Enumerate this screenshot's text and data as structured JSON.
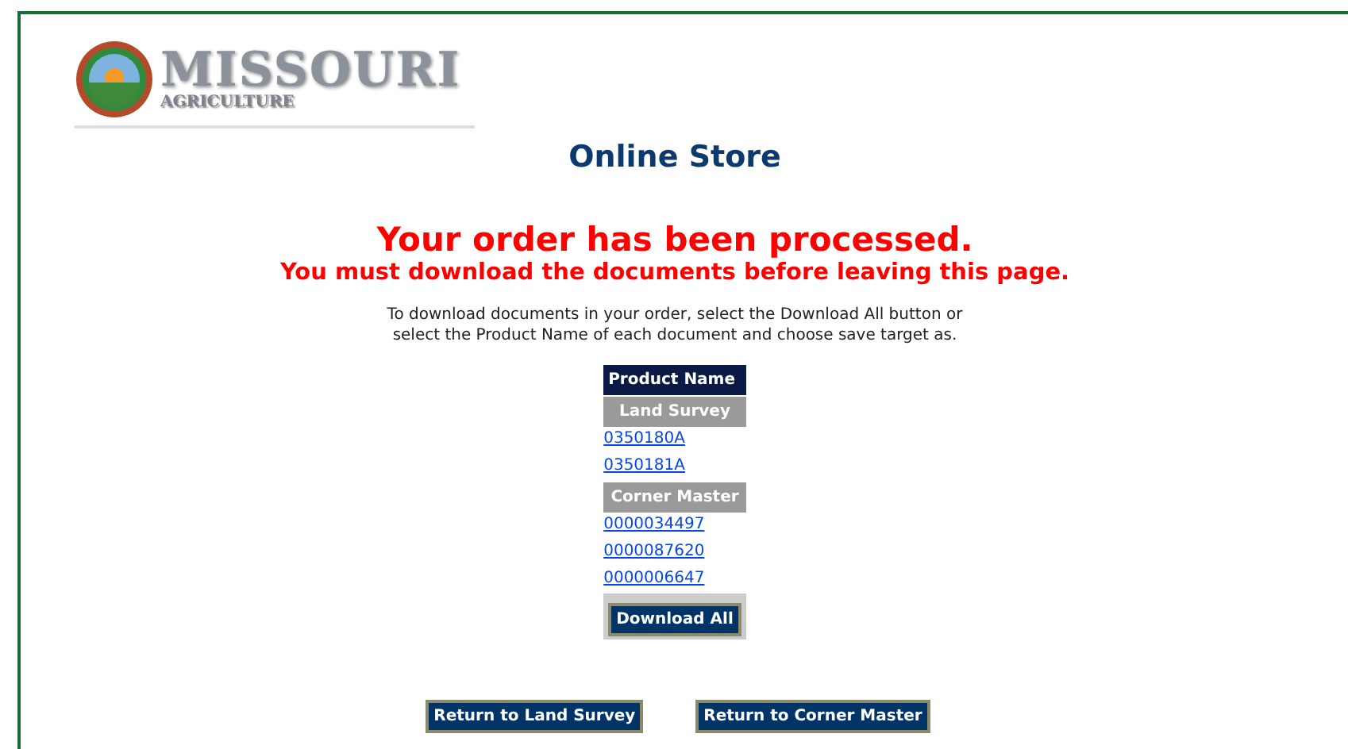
{
  "logo": {
    "title": "MISSOURI",
    "subtitle": "AGRICULTURE"
  },
  "page_title": "Online Store",
  "message": {
    "headline": "Your order has been processed.",
    "warning": "You must download the documents before leaving this page."
  },
  "instructions": [
    "To download documents in your order, select the Download All button or",
    "select the Product Name of each document and choose save target as."
  ],
  "table": {
    "header": "Product Name",
    "groups": [
      {
        "name": "Land Survey",
        "documents": [
          "0350180A",
          "0350181A"
        ]
      },
      {
        "name": "Corner Master",
        "documents": [
          "0000034497",
          "0000087620",
          "0000006647"
        ]
      }
    ],
    "download_button": "Download All"
  },
  "return_buttons": [
    "Return to Land Survey",
    "Return to Corner Master"
  ]
}
